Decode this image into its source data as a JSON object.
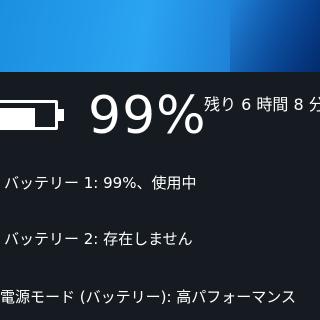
{
  "battery": {
    "icon": "battery-full-icon",
    "percent": "99%",
    "time_remaining": "残り 6 時間 8 分"
  },
  "details": {
    "battery1": "バッテリー 1: 99%、使用中",
    "battery2": "バッテリー 2: 存在しません"
  },
  "power_mode": {
    "label": "電源モード (バッテリー): 高パフォーマンス"
  },
  "colors": {
    "flyout_bg": "#151b20",
    "desktop_accent": "#2aa4f1",
    "text": "#ffffff"
  }
}
